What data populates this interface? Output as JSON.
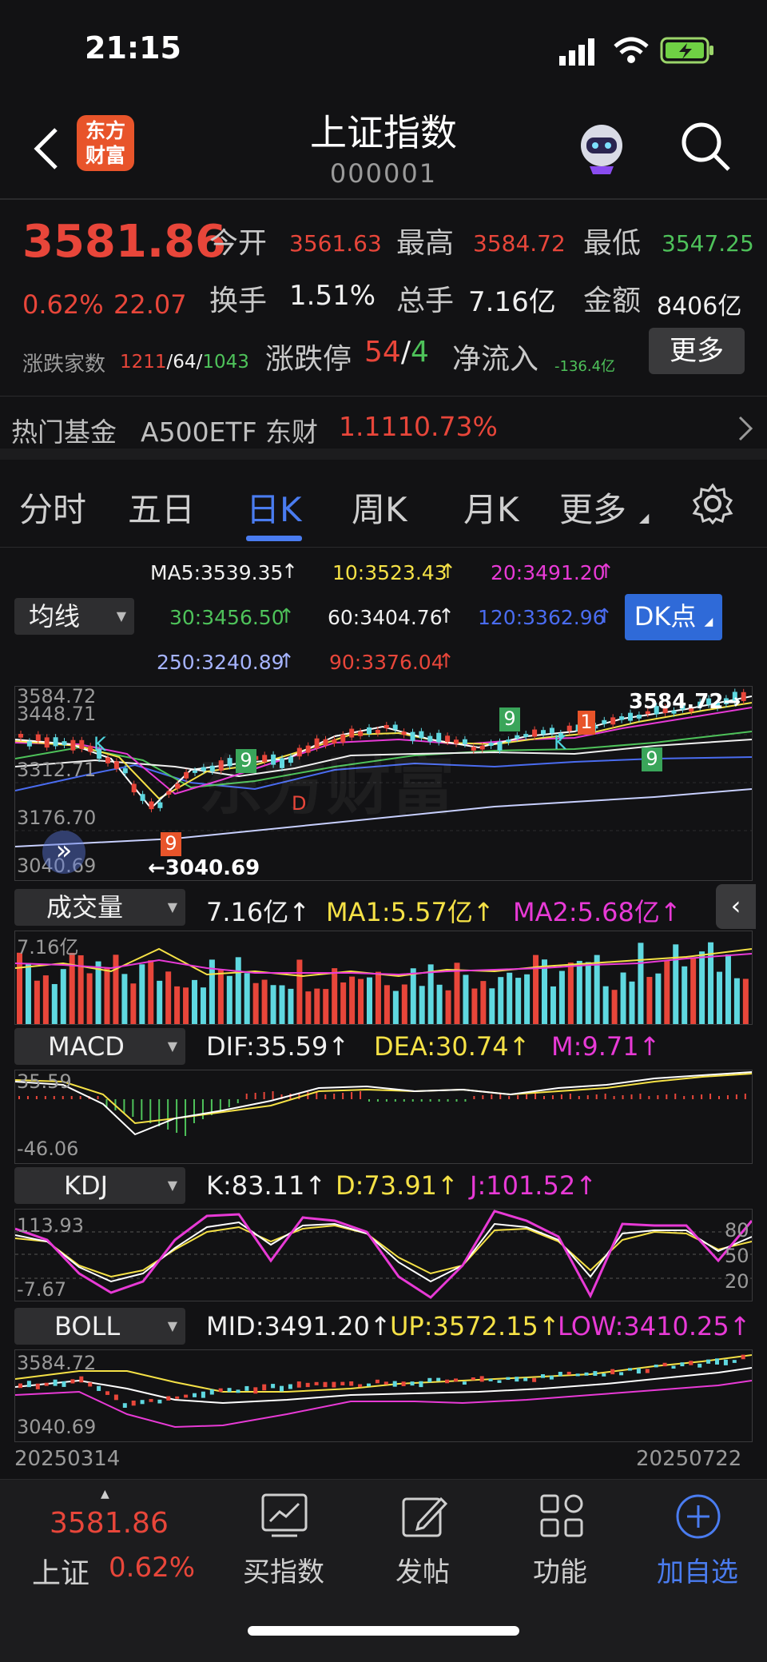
{
  "status": {
    "time": "21:15"
  },
  "header": {
    "logo_text": "东方财富",
    "title": "上证指数",
    "code": "000001"
  },
  "quote": {
    "price": "3581.86",
    "change_pct": "0.62%",
    "change": "22.07",
    "open_label": "今开",
    "open": "3561.63",
    "high_label": "最高",
    "high": "3584.72",
    "low_label": "最低",
    "low": "3547.25",
    "turnover_label": "换手",
    "turnover": "1.51%",
    "volume_label": "总手",
    "volume": "7.16亿",
    "amount_label": "金额",
    "amount": "8406亿",
    "breadth_label": "涨跌家数",
    "up_count": "1211",
    "flat_count": "64",
    "down_count": "1043",
    "limit_label": "涨跌停",
    "limit_up": "54",
    "limit_down": "4",
    "netflow_label": "净流入",
    "netflow": "-136.4亿",
    "more_label": "更多"
  },
  "fund": {
    "label": "热门基金",
    "name": "A500ETF 东财",
    "price": "1.111",
    "pct": "0.73%"
  },
  "tabs": [
    "分时",
    "五日",
    "日K",
    "周K",
    "月K",
    "更多"
  ],
  "active_tab": "日K",
  "ma": {
    "dropdown": "均线",
    "ma5": "MA5:3539.35",
    "ma10": "10:3523.43",
    "ma20": "20:3491.20",
    "ma30": "30:3456.50",
    "ma60": "60:3404.76",
    "ma120": "120:3362.96",
    "ma250": "250:3240.89",
    "ma90": "90:3376.04",
    "dk_label": "DK点"
  },
  "kline": {
    "y_labels": [
      "3584.72",
      "3448.71",
      "3312.71",
      "3176.70",
      "3040.69"
    ],
    "high_mark": "3584.72",
    "low_mark": "3040.69",
    "watermark": "东方财富",
    "signals": [
      "K",
      "K",
      "D",
      "9",
      "9",
      "9",
      "9",
      "1"
    ]
  },
  "volume": {
    "dropdown": "成交量",
    "value": "7.16亿",
    "ma1": "MA1:5.57亿",
    "ma2": "MA2:5.68亿",
    "y_label": "7.16亿"
  },
  "macd": {
    "dropdown": "MACD",
    "dif": "DIF:35.59",
    "dea": "DEA:30.74",
    "m": "M:9.71",
    "y_top": "35.59",
    "y_bottom": "-46.06"
  },
  "kdj": {
    "dropdown": "KDJ",
    "k": "K:83.11",
    "d": "D:73.91",
    "j": "J:101.52",
    "y_top": "113.93",
    "y_bottom": "-7.67",
    "r80": "80",
    "r50": "50",
    "r20": "20"
  },
  "boll": {
    "dropdown": "BOLL",
    "mid": "MID:3491.20",
    "up": "UP:3572.15",
    "low": "LOW:3410.25",
    "y_top": "3584.72",
    "y_bottom": "3040.69"
  },
  "dates": {
    "start": "20250314",
    "end": "20250722"
  },
  "bottom": {
    "price": "3581.86",
    "name": "上证",
    "pct": "0.62%",
    "items": [
      "买指数",
      "发帖",
      "功能",
      "加自选"
    ]
  },
  "colors": {
    "up": "#e8463a",
    "down": "#4ec25a",
    "accent": "#4a7cf0",
    "bg": "#121214"
  }
}
